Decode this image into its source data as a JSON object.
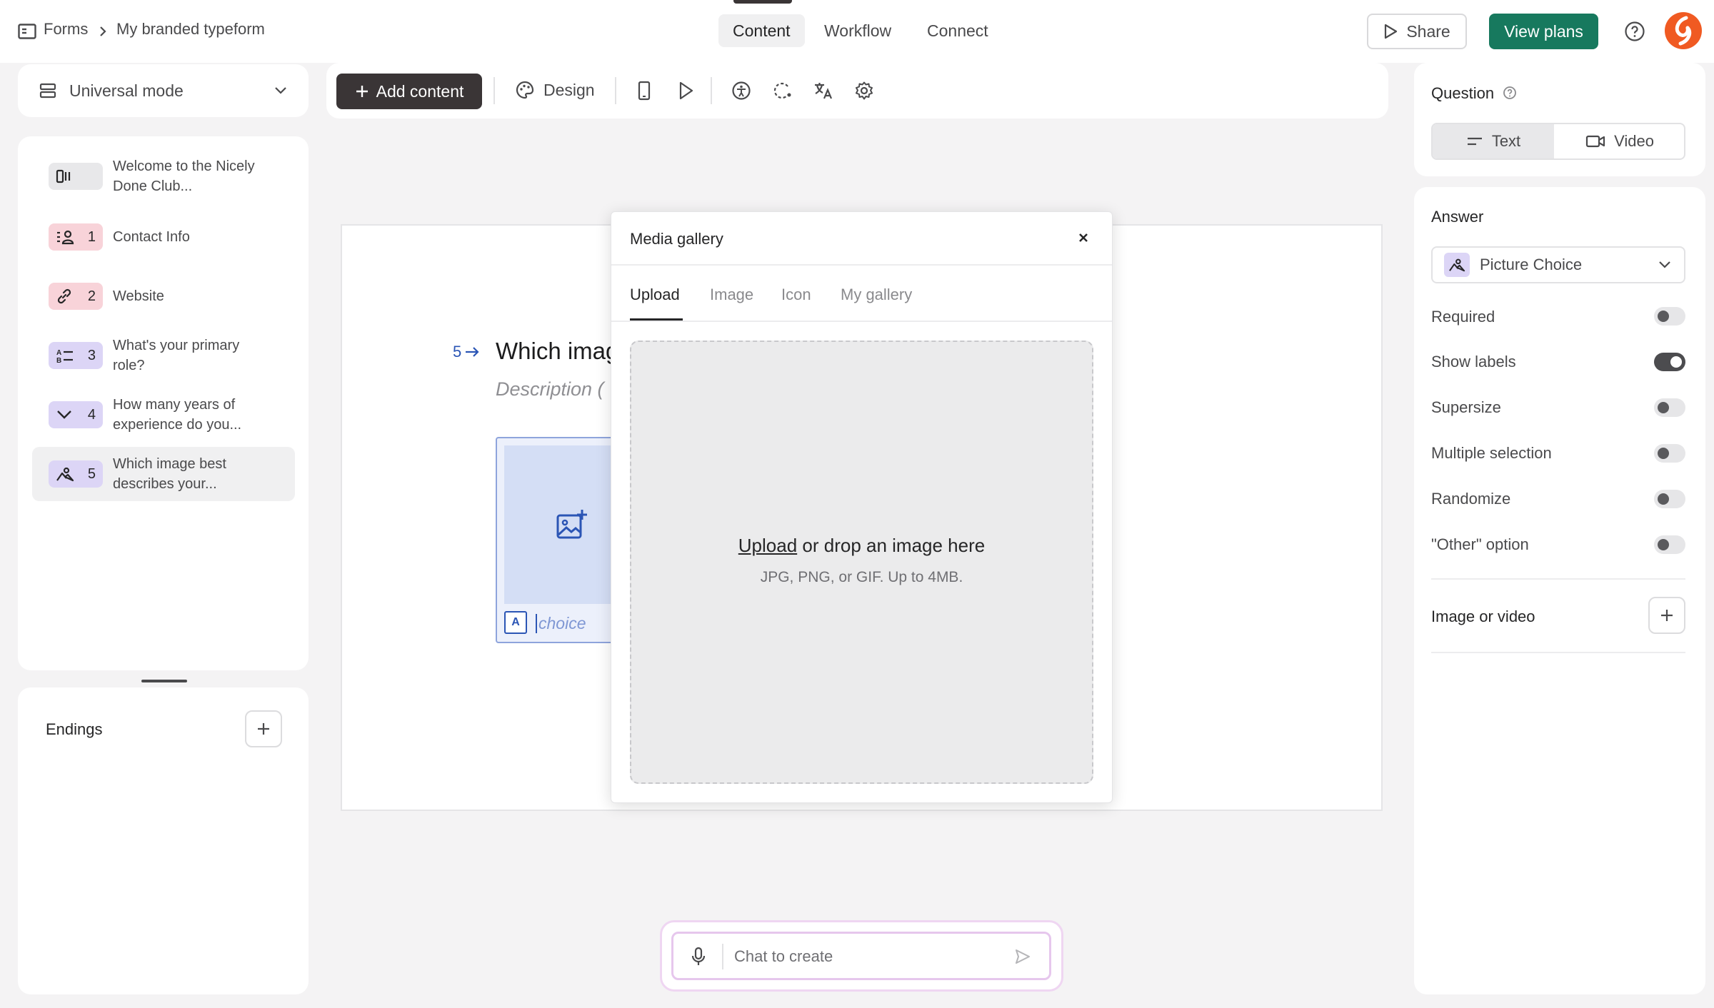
{
  "breadcrumb": {
    "root": "Forms",
    "current": "My branded typeform"
  },
  "nav_tabs": [
    "Content",
    "Workflow",
    "Connect"
  ],
  "header": {
    "share_label": "Share",
    "plans_label": "View plans"
  },
  "mode": {
    "label": "Universal mode"
  },
  "toolbar": {
    "add_content": "Add content",
    "design": "Design"
  },
  "questions": [
    {
      "number": "",
      "text": "Welcome to the Nicely Done Club...",
      "icon": "welcome-screen-icon",
      "color": "#e8e8ea"
    },
    {
      "number": "1",
      "text": "Contact Info",
      "icon": "contact-info-icon",
      "color": "#f8d3d9"
    },
    {
      "number": "2",
      "text": "Website",
      "icon": "link-icon",
      "color": "#f8d3d9"
    },
    {
      "number": "3",
      "text": "What's your primary role?",
      "icon": "multiple-choice-icon",
      "color": "#dcd5f6"
    },
    {
      "number": "4",
      "text": "How many years of experience do you...",
      "icon": "dropdown-icon",
      "color": "#dcd5f6"
    },
    {
      "number": "5",
      "text": "Which image best describes your...",
      "icon": "picture-choice-icon",
      "color": "#dcd5f6"
    }
  ],
  "endings": {
    "label": "Endings"
  },
  "canvas": {
    "question_number": "5",
    "question_text": "Which imag",
    "description": "Description (",
    "choice_letter": "A",
    "choice_placeholder": "choice"
  },
  "media_gallery": {
    "title": "Media gallery",
    "tabs": [
      "Upload",
      "Image",
      "Icon",
      "My gallery"
    ],
    "upload_link": "Upload",
    "upload_text": " or drop an image here",
    "upload_hint": "JPG, PNG, or GIF. Up to 4MB."
  },
  "chat": {
    "placeholder": "Chat to create"
  },
  "sidebar": {
    "question_label": "Question",
    "question_types": [
      "Text",
      "Video"
    ],
    "answer_label": "Answer",
    "answer_type": "Picture Choice",
    "settings": [
      {
        "label": "Required",
        "on": false
      },
      {
        "label": "Show labels",
        "on": true
      },
      {
        "label": "Supersize",
        "on": false
      },
      {
        "label": "Multiple selection",
        "on": false
      },
      {
        "label": "Randomize",
        "on": false
      },
      {
        "label": "\"Other\" option",
        "on": false
      }
    ],
    "image_or_video_label": "Image or video"
  },
  "colors": {
    "accent_green": "#17795e",
    "add_button": "#3a3536",
    "link_blue": "#2b55b5"
  }
}
